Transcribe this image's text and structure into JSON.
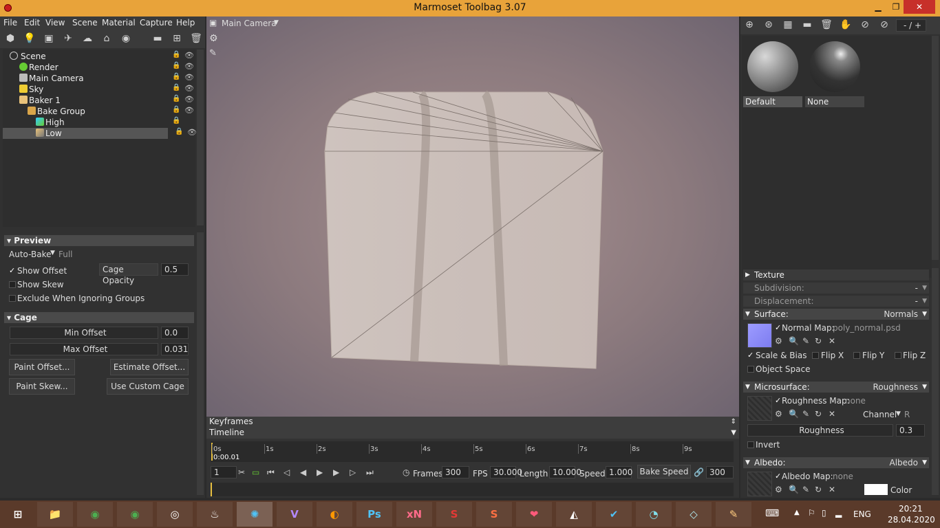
{
  "window": {
    "title": "Marmoset Toolbag 3.07",
    "min": "▁",
    "max": "❐",
    "close": "✕"
  },
  "menu": [
    "File",
    "Edit",
    "View",
    "Scene",
    "Material",
    "Capture",
    "Help"
  ],
  "scene_tree": {
    "items": [
      {
        "label": "Scene",
        "indent": 0
      },
      {
        "label": "Render",
        "indent": 1
      },
      {
        "label": "Main Camera",
        "indent": 1
      },
      {
        "label": "Sky",
        "indent": 1
      },
      {
        "label": "Baker 1",
        "indent": 1
      },
      {
        "label": "Bake Group",
        "indent": 2
      },
      {
        "label": "High",
        "indent": 3
      },
      {
        "label": "Low",
        "indent": 3
      }
    ]
  },
  "preview": {
    "header": "Preview",
    "auto_bake_label": "Auto-Bake",
    "auto_bake_value": "Full",
    "show_offset": "Show Offset",
    "cage_opacity_label": "Cage Opacity",
    "cage_opacity_value": "0.5",
    "show_skew": "Show Skew",
    "exclude": "Exclude When Ignoring Groups"
  },
  "cage": {
    "header": "Cage",
    "min_offset_label": "Min Offset",
    "min_offset_value": "0.0",
    "max_offset_label": "Max Offset",
    "max_offset_value": "0.031",
    "paint_offset": "Paint Offset...",
    "estimate_offset": "Estimate Offset...",
    "paint_skew": "Paint Skew...",
    "use_custom_cage": "Use Custom Cage"
  },
  "viewport": {
    "camera": "Main Camera"
  },
  "keyframes": {
    "label": "Keyframes"
  },
  "timeline": {
    "label": "Timeline",
    "current_time": "0:00.01",
    "ticks": [
      "0s",
      "1s",
      "2s",
      "3s",
      "4s",
      "5s",
      "6s",
      "7s",
      "8s",
      "9s"
    ],
    "frame": "1",
    "frames_label": "Frames",
    "frames_value": "300",
    "fps_label": "FPS",
    "fps_value": "30.000",
    "length_label": "Length",
    "length_value": "10.000",
    "speed_label": "Speed",
    "speed_value": "1.000",
    "bake_speed": "Bake Speed",
    "bake_value": "300"
  },
  "materials": {
    "page": "- / +",
    "items": [
      {
        "name": "Default"
      },
      {
        "name": "None"
      }
    ]
  },
  "properties": {
    "texture": "Texture",
    "subdivision": "Subdivision:",
    "subdivision_value": "-",
    "displacement": "Displacement:",
    "displacement_value": "-",
    "surface": "Surface:",
    "surface_value": "Normals",
    "normal_map_label": "Normal Map:",
    "normal_map_value": "poly_normal.psd",
    "scale_bias": "Scale & Bias",
    "flip_x": "Flip X",
    "flip_y": "Flip Y",
    "flip_z": "Flip Z",
    "object_space": "Object Space",
    "microsurface": "Microsurface:",
    "microsurface_value": "Roughness",
    "roughness_map_label": "Roughness Map:",
    "roughness_map_value": "none",
    "channel_label": "Channel",
    "channel_value": "R",
    "roughness_label": "Roughness",
    "roughness_value": "0.3",
    "invert": "Invert",
    "albedo": "Albedo:",
    "albedo_value": "Albedo",
    "albedo_map_label": "Albedo Map:",
    "albedo_map_value": "none",
    "color_label": "Color"
  },
  "taskbar": {
    "apps": [
      "⊞",
      "📁",
      "◉",
      "◉",
      "◎",
      "♨",
      "✺",
      "V",
      "◐",
      "Ps",
      "xN",
      "S",
      "S",
      "❤",
      "◭",
      "✔",
      "◔",
      "◇",
      "✎"
    ],
    "lang": "ENG",
    "time": "20:21",
    "date": "28.04.2020"
  }
}
